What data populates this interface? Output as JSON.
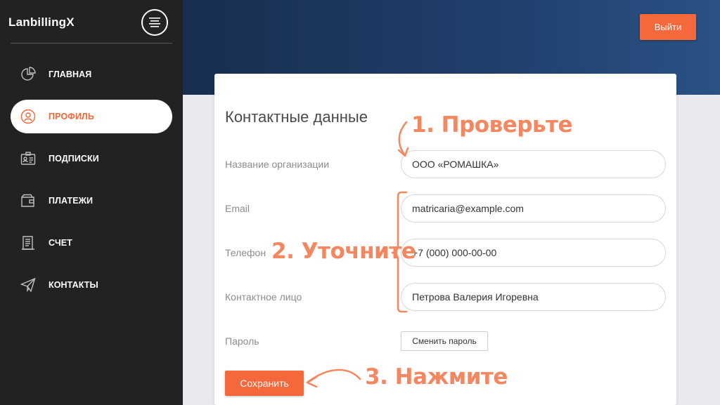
{
  "sidebar": {
    "brand": "LanbillingX",
    "items": [
      {
        "label": "ГЛАВНАЯ",
        "icon": "pie-chart-icon"
      },
      {
        "label": "ПРОФИЛЬ",
        "icon": "user-icon"
      },
      {
        "label": "ПОДПИСКИ",
        "icon": "id-card-icon"
      },
      {
        "label": "ПЛАТЕЖИ",
        "icon": "wallet-icon"
      },
      {
        "label": "СЧЕТ",
        "icon": "receipt-icon"
      },
      {
        "label": "КОНТАКТЫ",
        "icon": "paper-plane-icon"
      }
    ],
    "active_index": 1
  },
  "header": {
    "logout_label": "Выйти"
  },
  "form": {
    "title": "Контактные данные",
    "fields": [
      {
        "label": "Название организации",
        "value": "ООО «РОМАШКА»"
      },
      {
        "label": "Email",
        "value": "matricaria@example.com"
      },
      {
        "label": "Телефон",
        "value": "+7 (000) 000-00-00"
      },
      {
        "label": "Контактное лицо",
        "value": "Петрова Валерия Игоревна"
      }
    ],
    "password_label": "Пароль",
    "change_password_label": "Сменить пароль",
    "save_label": "Сохранить"
  },
  "annotations": {
    "step1": "1. Проверьте",
    "step2": "2. Уточните",
    "step3": "3. Нажмите"
  },
  "colors": {
    "accent": "#f4683b",
    "annotation": "#f4875f",
    "sidebar_bg": "#232220",
    "header_bg": "#20406d"
  }
}
